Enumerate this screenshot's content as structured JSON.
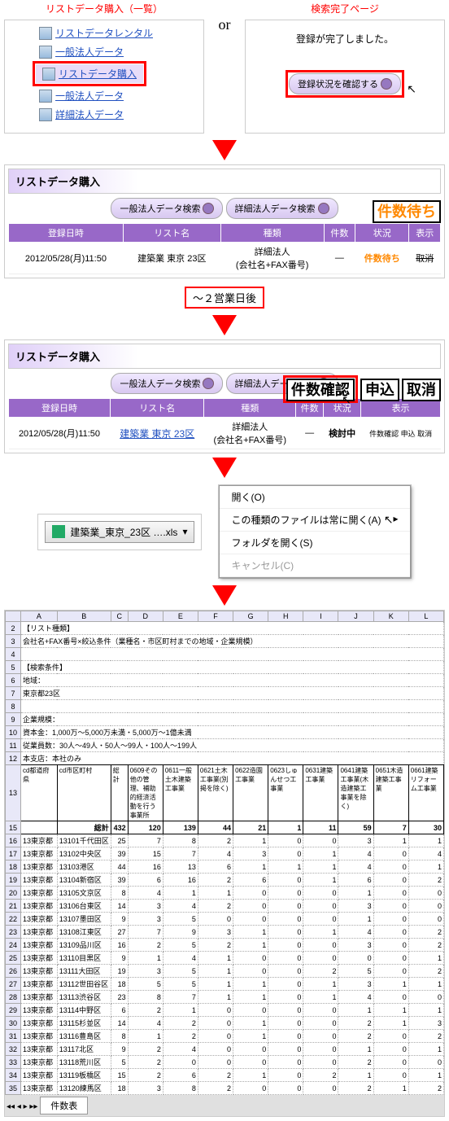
{
  "top": {
    "left_title": "リストデータ購入（一覧）",
    "right_title": "検索完了ページ",
    "nav": [
      "リストデータレンタル",
      "一般法人データ",
      "リストデータ購入",
      "一般法人データ",
      "詳細法人データ"
    ],
    "or": "or",
    "reg_msg": "登録が完了しました。",
    "confirm_btn": "登録状況を確認する"
  },
  "panel": {
    "title": "リストデータ購入",
    "btn1": "一般法人データ検索",
    "btn2": "詳細法人データ検索",
    "cols": [
      "登録日時",
      "リスト名",
      "種類",
      "件数",
      "状況",
      "表示"
    ],
    "date": "2012/05/28(月)11:50",
    "name": "建築業 東京 23区",
    "type": "詳細法人\n(会社名+FAX番号)",
    "status1": "件数待ち",
    "cancel": "取消",
    "badge_wait": "件数待ち",
    "badge_confirm": "件数確認",
    "badge_apply": "申込",
    "badge_cancel": "取消",
    "status2": "検討中",
    "action": "件数確認",
    "small_actions": "件数確認 申込 取消"
  },
  "mid": {
    "days": "～２営業日後"
  },
  "dl": {
    "file": "建築業_東京_23区 ….xls",
    "menu": [
      "開く(O)",
      "この種類のファイルは常に開く(A)",
      "フォルダを開く(S)",
      "キャンセル(C)"
    ]
  },
  "xl": {
    "cols": [
      "A",
      "B",
      "C",
      "D",
      "E",
      "F",
      "G",
      "H",
      "I",
      "J",
      "K",
      "L"
    ],
    "info": [
      "【リスト種類】",
      "会社名+FAX番号×絞込条件（業種名・市区町村までの地域・企業規模）",
      "",
      "【検索条件】",
      "地域：",
      "東京都23区",
      "",
      "企業規模：",
      "資本金：1,000万〜5,000万未満・5,000万〜1億未満",
      "従業員数：30人〜49人・50人〜99人・100人〜199人",
      "本支店：本社のみ"
    ],
    "hdr": [
      "cd都道府県",
      "cd市区町村",
      "総計",
      "0609その他の管理、補助的経済活動を行う事業所",
      "0611一般土木建築工事業",
      "0621土木工事業(別掲を除く)",
      "0622造園工事業",
      "0623しゅんせつ工事業",
      "0631建築工事業",
      "0641建築工事業(木造建築工事業を除く)",
      "0651木造建築工事業",
      "0661建築リフォーム工事業"
    ],
    "total": [
      "",
      "総計",
      "432",
      "120",
      "139",
      "44",
      "21",
      "1",
      "11",
      "59",
      "7",
      "30"
    ],
    "rows": [
      [
        "13東京都",
        "13101千代田区",
        "25",
        "7",
        "8",
        "2",
        "1",
        "0",
        "0",
        "3",
        "1",
        "1"
      ],
      [
        "13東京都",
        "13102中央区",
        "39",
        "15",
        "7",
        "4",
        "3",
        "0",
        "1",
        "4",
        "0",
        "4"
      ],
      [
        "13東京都",
        "13103港区",
        "44",
        "16",
        "13",
        "6",
        "1",
        "1",
        "1",
        "4",
        "0",
        "1"
      ],
      [
        "13東京都",
        "13104新宿区",
        "39",
        "6",
        "16",
        "2",
        "6",
        "0",
        "1",
        "6",
        "0",
        "2"
      ],
      [
        "13東京都",
        "13105文京区",
        "8",
        "4",
        "1",
        "1",
        "0",
        "0",
        "0",
        "1",
        "0",
        "0"
      ],
      [
        "13東京都",
        "13106台東区",
        "14",
        "3",
        "4",
        "2",
        "0",
        "0",
        "0",
        "3",
        "0",
        "0"
      ],
      [
        "13東京都",
        "13107墨田区",
        "9",
        "3",
        "5",
        "0",
        "0",
        "0",
        "0",
        "1",
        "0",
        "0"
      ],
      [
        "13東京都",
        "13108江東区",
        "27",
        "7",
        "9",
        "3",
        "1",
        "0",
        "1",
        "4",
        "0",
        "2"
      ],
      [
        "13東京都",
        "13109品川区",
        "16",
        "2",
        "5",
        "2",
        "1",
        "0",
        "0",
        "3",
        "0",
        "2"
      ],
      [
        "13東京都",
        "13110目黒区",
        "9",
        "1",
        "4",
        "1",
        "0",
        "0",
        "0",
        "0",
        "0",
        "1"
      ],
      [
        "13東京都",
        "13111大田区",
        "19",
        "3",
        "5",
        "1",
        "0",
        "0",
        "2",
        "5",
        "0",
        "2"
      ],
      [
        "13東京都",
        "13112世田谷区",
        "18",
        "5",
        "5",
        "1",
        "1",
        "0",
        "1",
        "3",
        "1",
        "1"
      ],
      [
        "13東京都",
        "13113渋谷区",
        "23",
        "8",
        "7",
        "1",
        "1",
        "0",
        "1",
        "4",
        "0",
        "0"
      ],
      [
        "13東京都",
        "13114中野区",
        "6",
        "2",
        "1",
        "0",
        "0",
        "0",
        "0",
        "1",
        "1",
        "1"
      ],
      [
        "13東京都",
        "13115杉並区",
        "14",
        "4",
        "2",
        "0",
        "1",
        "0",
        "0",
        "2",
        "1",
        "3"
      ],
      [
        "13東京都",
        "13116豊島区",
        "8",
        "1",
        "2",
        "0",
        "1",
        "0",
        "0",
        "2",
        "0",
        "2"
      ],
      [
        "13東京都",
        "13117北区",
        "9",
        "2",
        "4",
        "0",
        "0",
        "0",
        "0",
        "1",
        "0",
        "1"
      ],
      [
        "13東京都",
        "13118荒川区",
        "5",
        "2",
        "0",
        "0",
        "0",
        "0",
        "0",
        "2",
        "0",
        "0"
      ],
      [
        "13東京都",
        "13119板橋区",
        "15",
        "2",
        "6",
        "2",
        "1",
        "0",
        "2",
        "1",
        "0",
        "1"
      ],
      [
        "13東京都",
        "13120練馬区",
        "18",
        "3",
        "8",
        "2",
        "0",
        "0",
        "0",
        "2",
        "1",
        "2"
      ]
    ],
    "sheet": "件数表"
  }
}
